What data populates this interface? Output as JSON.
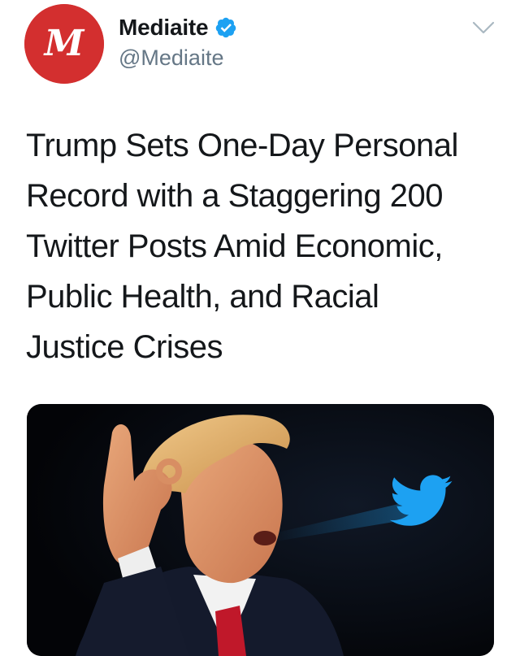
{
  "account": {
    "display_name": "Mediaite",
    "handle": "@Mediaite",
    "verified": true,
    "avatar_letter": "M",
    "avatar_color": "#d32f2f"
  },
  "tweet": {
    "text": "Trump Sets One-Day Personal\nRecord with a Staggering 200\nTwitter Posts Amid Economic,\nPublic Health, and Racial\nJustice Crises"
  },
  "media": {
    "image_description_icon": "twitter-bird-icon",
    "background_color": "#05070b",
    "bird_color": "#1da1f2"
  },
  "icons": {
    "verified": "verified-badge-icon",
    "menu": "chevron-down-icon"
  },
  "colors": {
    "text": "#14171a",
    "secondary": "#657786",
    "verified": "#1da1f2"
  }
}
